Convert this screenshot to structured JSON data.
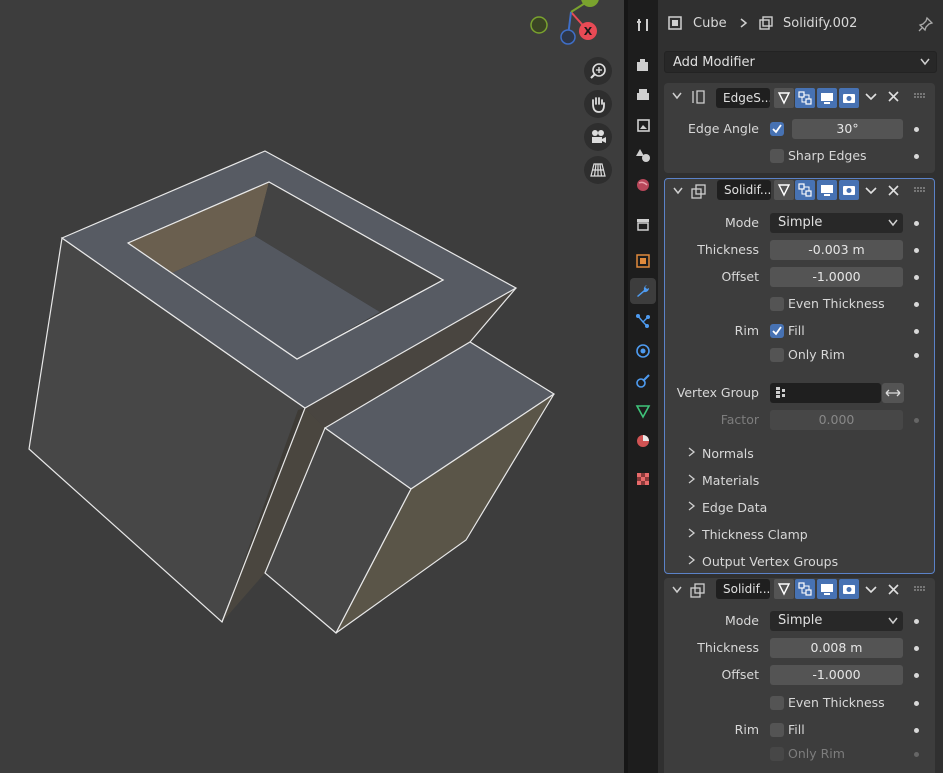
{
  "header": {
    "object_name": "Cube",
    "modifier_name": "Solidify.002"
  },
  "add_modifier_label": "Add Modifier",
  "colors": {
    "active_tab": "#4772b3",
    "panel_bg": "#303030",
    "viewport_bg": "#3d3d3d",
    "gizmo_x": "#e84a55",
    "gizmo_y": "#7aa32e",
    "gizmo_z": "#3f6fc8"
  },
  "gizmo": {
    "x_label": "X"
  },
  "tabs": [
    "tool-icon",
    "render-icon",
    "output-icon",
    "view-layer-icon",
    "scene-icon",
    "world-icon",
    "collection-icon",
    "object-icon",
    "modifier-icon",
    "particles-icon",
    "physics-icon",
    "constraints-icon",
    "data-icon",
    "material-icon",
    "texture-icon"
  ],
  "modifiers": [
    {
      "name": "EdgeS...",
      "edge_angle_label": "Edge Angle",
      "edge_angle_value": "30°",
      "edge_angle_checked": true,
      "sharp_edges_label": "Sharp Edges",
      "sharp_edges_checked": false
    },
    {
      "name": "Solidif...",
      "mode_label": "Mode",
      "mode_value": "Simple",
      "thickness_label": "Thickness",
      "thickness_value": "-0.003 m",
      "offset_label": "Offset",
      "offset_value": "-1.0000",
      "even_thickness_label": "Even Thickness",
      "even_thickness_checked": false,
      "rim_label": "Rim",
      "fill_label": "Fill",
      "fill_checked": true,
      "only_rim_label": "Only Rim",
      "only_rim_checked": false,
      "vertex_group_label": "Vertex Group",
      "vertex_group_value": "",
      "factor_label": "Factor",
      "factor_value": "0.000",
      "subpanels": [
        "Normals",
        "Materials",
        "Edge Data",
        "Thickness Clamp",
        "Output Vertex Groups"
      ]
    },
    {
      "name": "Solidif...",
      "mode_label": "Mode",
      "mode_value": "Simple",
      "thickness_label": "Thickness",
      "thickness_value": "0.008 m",
      "offset_label": "Offset",
      "offset_value": "-1.0000",
      "even_thickness_label": "Even Thickness",
      "even_thickness_checked": false,
      "rim_label": "Rim",
      "fill_label": "Fill",
      "fill_checked": false,
      "only_rim_label": "Only Rim",
      "only_rim_checked": false
    }
  ]
}
